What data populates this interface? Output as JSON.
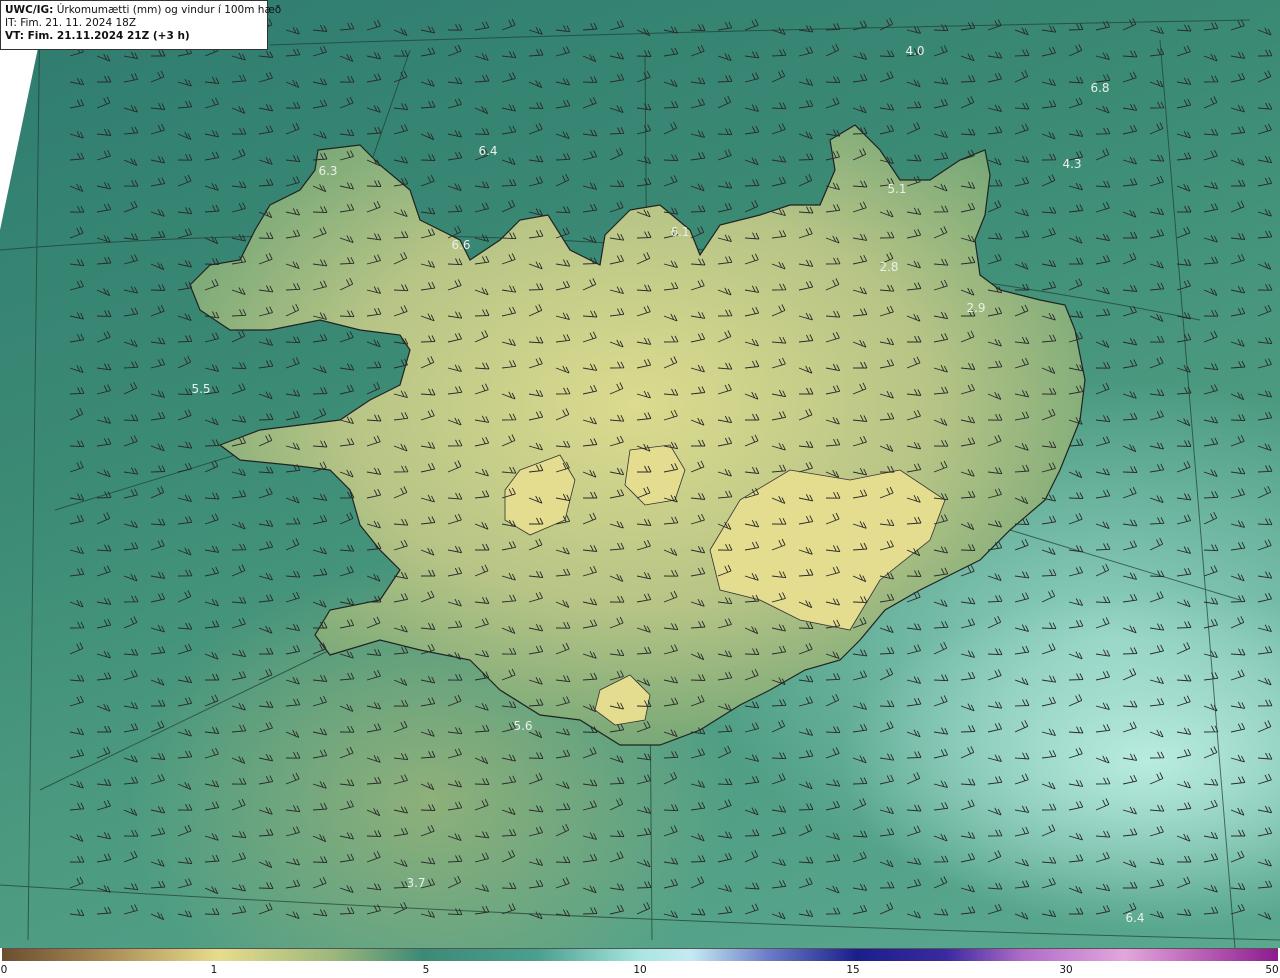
{
  "header": {
    "model": "UWC/IG:",
    "title": "Úrkomumætti (mm) og vindur í 100m hæð",
    "init_time": "IT: Fim. 21. 11. 2024 18Z",
    "valid_time": "VT: Fim. 21.11.2024 21Z (+3 h)"
  },
  "map_labels": [
    "4.0",
    "6.8",
    "6.4",
    "6.3",
    "4.3",
    "5.1",
    "6.1",
    "6.6",
    "2.8",
    "2.9",
    "5.5",
    "5.6",
    "3.7",
    "6.4"
  ],
  "colorbar": {
    "ticks": [
      "0",
      "1",
      "5",
      "10",
      "15",
      "30",
      "50"
    ],
    "colors": [
      "#6b4e2e",
      "#e7dc8c",
      "#3c8a76",
      "#a9e6e0",
      "#1a1f8a",
      "#b06cc8",
      "#8e1a8e"
    ]
  },
  "colors": {
    "ocean": "#3b8a74",
    "land_high": "#d6d98e",
    "land_low": "#5b9a6c",
    "coastline": "#222222",
    "wind_barb": "#2a2a2a"
  }
}
